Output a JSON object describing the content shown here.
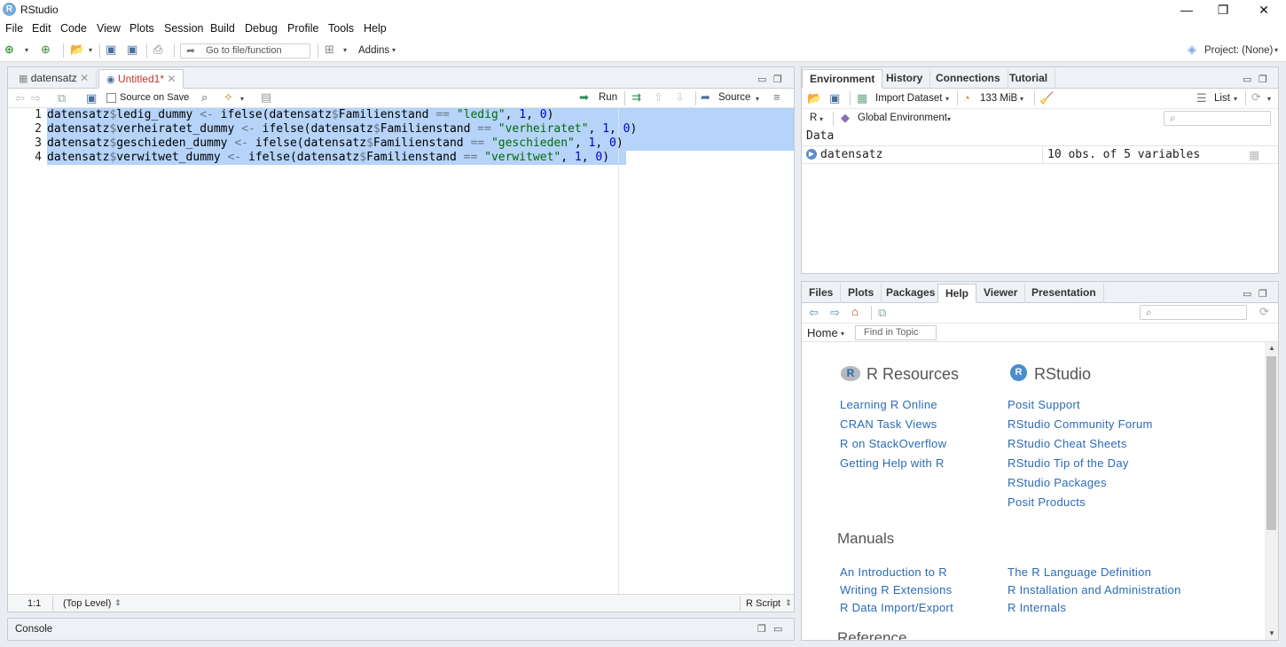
{
  "window": {
    "title": "RStudio",
    "logo_letter": "R",
    "controls": [
      "—",
      "❐",
      "✕"
    ]
  },
  "menu": [
    "File",
    "Edit",
    "Code",
    "View",
    "Plots",
    "Session",
    "Build",
    "Debug",
    "Profile",
    "Tools",
    "Help"
  ],
  "toolbar": {
    "goto_placeholder": "Go to file/function",
    "addins_label": "Addins",
    "project_label": "Project: (None)"
  },
  "editor": {
    "tabs": [
      {
        "label": "datensatz",
        "close": "✕"
      },
      {
        "label": "Untitled1*",
        "close": "✕"
      }
    ],
    "source_on_save": "Source on Save",
    "run_label": "Run",
    "source_label": "Source",
    "line_numbers": [
      "1",
      "2",
      "3",
      "4"
    ],
    "lines": [
      [
        {
          "t": "datensatz",
          "c": ""
        },
        {
          "t": "$",
          "c": "op"
        },
        {
          "t": "ledig_dummy ",
          "c": ""
        },
        {
          "t": "<-",
          "c": "op"
        },
        {
          "t": " ifelse(datensatz",
          "c": ""
        },
        {
          "t": "$",
          "c": "op"
        },
        {
          "t": "Familienstand ",
          "c": ""
        },
        {
          "t": "==",
          "c": "op"
        },
        {
          "t": " ",
          "c": ""
        },
        {
          "t": "\"ledig\"",
          "c": "str"
        },
        {
          "t": ", ",
          "c": ""
        },
        {
          "t": "1",
          "c": "num"
        },
        {
          "t": ", ",
          "c": ""
        },
        {
          "t": "0",
          "c": "num"
        },
        {
          "t": ")",
          "c": ""
        }
      ],
      [
        {
          "t": "datensatz",
          "c": ""
        },
        {
          "t": "$",
          "c": "op"
        },
        {
          "t": "verheiratet_dummy ",
          "c": ""
        },
        {
          "t": "<-",
          "c": "op"
        },
        {
          "t": " ifelse(datensatz",
          "c": ""
        },
        {
          "t": "$",
          "c": "op"
        },
        {
          "t": "Familienstand ",
          "c": ""
        },
        {
          "t": "==",
          "c": "op"
        },
        {
          "t": " ",
          "c": ""
        },
        {
          "t": "\"verheiratet\"",
          "c": "str"
        },
        {
          "t": ", ",
          "c": ""
        },
        {
          "t": "1",
          "c": "num"
        },
        {
          "t": ", ",
          "c": ""
        },
        {
          "t": "0",
          "c": "num"
        },
        {
          "t": ")",
          "c": ""
        }
      ],
      [
        {
          "t": "datensatz",
          "c": ""
        },
        {
          "t": "$",
          "c": "op"
        },
        {
          "t": "geschieden_dummy ",
          "c": ""
        },
        {
          "t": "<-",
          "c": "op"
        },
        {
          "t": " ifelse(datensatz",
          "c": ""
        },
        {
          "t": "$",
          "c": "op"
        },
        {
          "t": "Familienstand ",
          "c": ""
        },
        {
          "t": "==",
          "c": "op"
        },
        {
          "t": " ",
          "c": ""
        },
        {
          "t": "\"geschieden\"",
          "c": "str"
        },
        {
          "t": ", ",
          "c": ""
        },
        {
          "t": "1",
          "c": "num"
        },
        {
          "t": ", ",
          "c": ""
        },
        {
          "t": "0",
          "c": "num"
        },
        {
          "t": ")",
          "c": ""
        }
      ],
      [
        {
          "t": "datensatz",
          "c": ""
        },
        {
          "t": "$",
          "c": "op"
        },
        {
          "t": "verwitwet_dummy ",
          "c": ""
        },
        {
          "t": "<-",
          "c": "op"
        },
        {
          "t": " ifelse(datensatz",
          "c": ""
        },
        {
          "t": "$",
          "c": "op"
        },
        {
          "t": "Familienstand ",
          "c": ""
        },
        {
          "t": "==",
          "c": "op"
        },
        {
          "t": " ",
          "c": ""
        },
        {
          "t": "\"verwitwet\"",
          "c": "str"
        },
        {
          "t": ", ",
          "c": ""
        },
        {
          "t": "1",
          "c": "num"
        },
        {
          "t": ", ",
          "c": ""
        },
        {
          "t": "0",
          "c": "num"
        },
        {
          "t": ")",
          "c": ""
        }
      ]
    ],
    "status_position": "1:1",
    "status_scope": "(Top Level)",
    "status_type": "R Script"
  },
  "console": {
    "label": "Console"
  },
  "environment": {
    "tabs": [
      "Environment",
      "History",
      "Connections",
      "Tutorial"
    ],
    "import_dataset": "Import Dataset",
    "memory": "133 MiB",
    "list_label": "List",
    "r_label": "R",
    "global_env": "Global Environment",
    "section": "Data",
    "rows": [
      {
        "name": "datensatz",
        "value": "10 obs. of 5 variables"
      }
    ]
  },
  "files_pane": {
    "tabs": [
      "Files",
      "Plots",
      "Packages",
      "Help",
      "Viewer",
      "Presentation"
    ],
    "home_label": "Home",
    "find_placeholder": "Find in Topic",
    "r_resources_title": "R Resources",
    "rstudio_title": "RStudio",
    "r_resources": [
      "Learning R Online",
      "CRAN Task Views",
      "R on StackOverflow",
      "Getting Help with R"
    ],
    "rstudio_links": [
      "Posit Support",
      "RStudio Community Forum",
      "RStudio Cheat Sheets",
      "RStudio Tip of the Day",
      "RStudio Packages",
      "Posit Products"
    ],
    "manuals_title": "Manuals",
    "manuals_left": [
      "An Introduction to R",
      "Writing R Extensions",
      "R Data Import/Export"
    ],
    "manuals_right": [
      "The R Language Definition",
      "R Installation and Administration",
      "R Internals"
    ],
    "reference_title": "Reference"
  }
}
